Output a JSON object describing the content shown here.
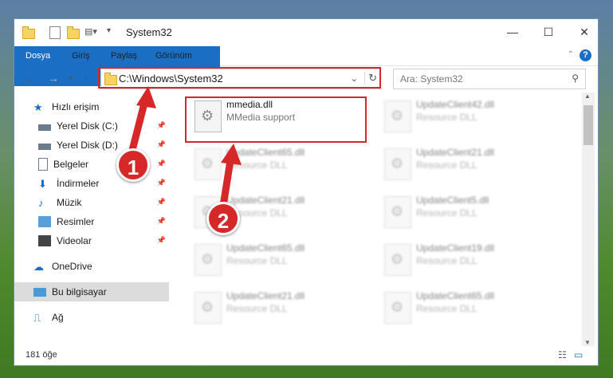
{
  "window": {
    "title": "System32"
  },
  "ribbon": {
    "tabs": [
      "Dosya",
      "Giriş",
      "Paylaş",
      "Görünüm"
    ]
  },
  "address": {
    "path": "C:\\Windows\\System32",
    "search_placeholder": "Ara: System32"
  },
  "sidebar": {
    "items": [
      {
        "label": "Hızlı erişim",
        "icon": "star-icon",
        "pinned": false
      },
      {
        "label": "Yerel Disk (C:)",
        "icon": "drive-icon",
        "pinned": true
      },
      {
        "label": "Yerel Disk (D:)",
        "icon": "drive-icon",
        "pinned": true
      },
      {
        "label": "Belgeler",
        "icon": "documents-icon",
        "pinned": true
      },
      {
        "label": "İndirmeler",
        "icon": "downloads-icon",
        "pinned": true
      },
      {
        "label": "Müzik",
        "icon": "music-icon",
        "pinned": true
      },
      {
        "label": "Resimler",
        "icon": "pictures-icon",
        "pinned": true
      },
      {
        "label": "Videolar",
        "icon": "videos-icon",
        "pinned": true
      },
      {
        "label": "OneDrive",
        "icon": "cloud-icon",
        "pinned": false
      },
      {
        "label": "Bu bilgisayar",
        "icon": "computer-icon",
        "pinned": false
      },
      {
        "label": "Ağ",
        "icon": "network-icon",
        "pinned": false
      }
    ]
  },
  "files": [
    {
      "name": "mmedia.dll",
      "desc": "MMedia support"
    },
    {
      "name": "UpdateClient42.dll",
      "desc": "Resource DLL"
    },
    {
      "name": "UpdateClient65.dll",
      "desc": "Resource DLL"
    },
    {
      "name": "UpdateClient21.dll",
      "desc": "Resource DLL"
    },
    {
      "name": "UpdateClient21.dll",
      "desc": "Resource DLL"
    },
    {
      "name": "UpdateClient5.dll",
      "desc": "Resource DLL"
    },
    {
      "name": "UpdateClient65.dll",
      "desc": "Resource DLL"
    },
    {
      "name": "UpdateClient19.dll",
      "desc": "Resource DLL"
    },
    {
      "name": "UpdateClient21.dll",
      "desc": "Resource DLL"
    },
    {
      "name": "UpdateClient65.dll",
      "desc": "Resource DLL"
    }
  ],
  "status": {
    "count": "181 öğe"
  },
  "annotations": {
    "marker1": "1",
    "marker2": "2"
  },
  "colors": {
    "accent": "#1a6fc4",
    "highlight": "#d62828"
  }
}
